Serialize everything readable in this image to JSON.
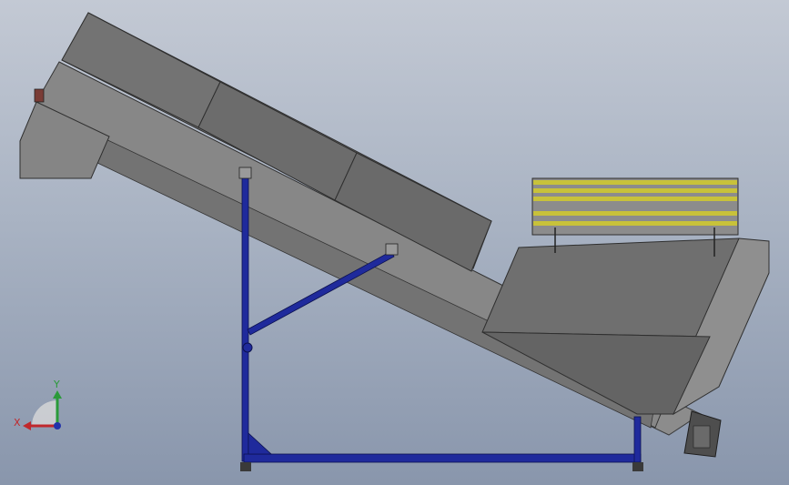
{
  "view": {
    "background_top": "#c3c9d4",
    "background_bottom": "#8996ac"
  },
  "colors": {
    "frame_blue": "#1f2a9c",
    "hopper_gray": "#7a7a7a",
    "housing_gray": "#8a8a8a",
    "rail_yellow": "#c8c23a",
    "motor_dark": "#4a4a4a"
  },
  "triad": {
    "x_label": "X",
    "y_label": "Y",
    "x_color": "#c0282c",
    "y_color": "#2a9a3a",
    "z_color": "#2233aa"
  }
}
